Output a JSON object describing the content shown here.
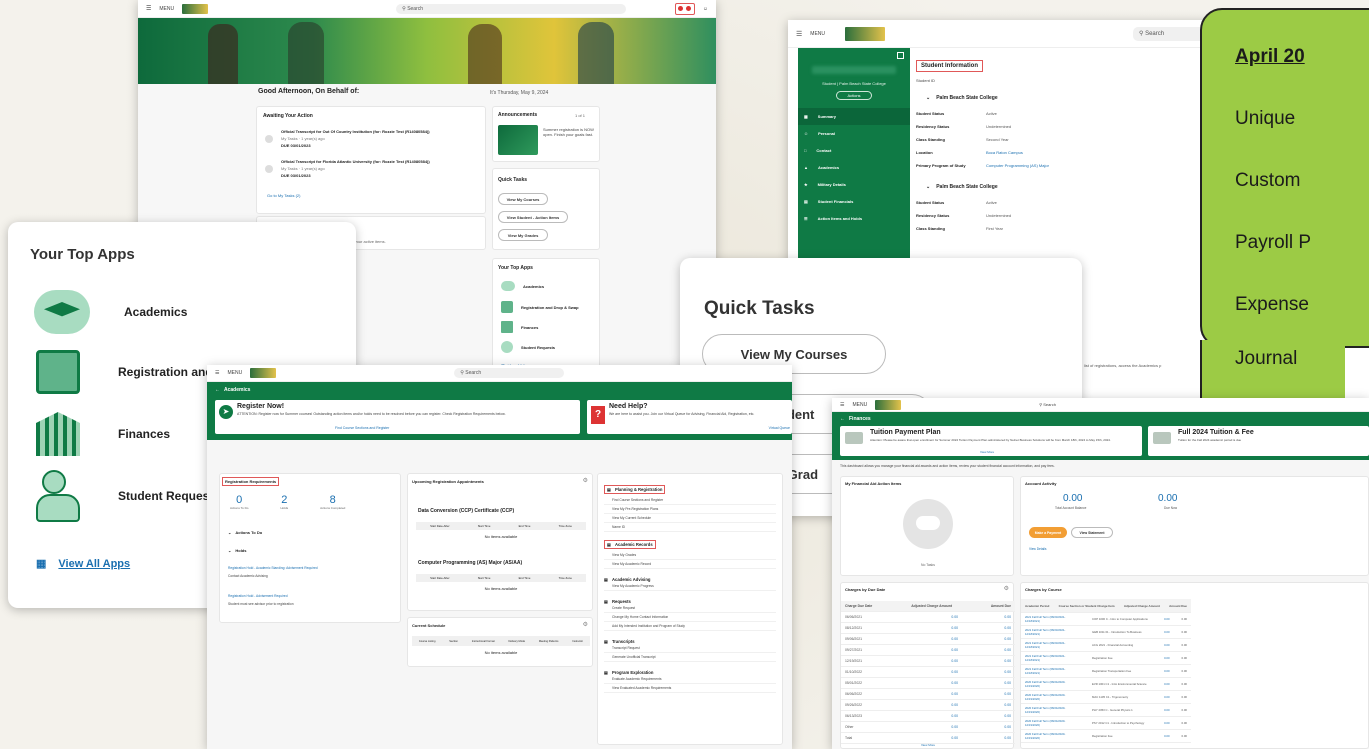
{
  "dashboard": {
    "menu": "MENU",
    "search_placeholder": "Search",
    "greeting": "Good Afternoon, On Behalf of:",
    "date_text": "It's Thursday, May 9, 2024",
    "awaiting_title": "Awaiting Your Action",
    "task1_title": "Official Transcript for Out Of Country Institution (for: Rozzie Test (R14080584))",
    "task1_meta": "My Tasks · 1 year(s) ago",
    "task1_date": "DUE 03/01/2023",
    "task2_title": "Official Transcript for Florida Atlantic University (for: Rozzie Test (R14080584))",
    "task2_meta": "My Tasks · 1 year(s) ago",
    "task2_date": "DUE 03/01/2023",
    "go_to_tasks": "Go to My Tasks (2)",
    "updates_text": "get updates on your active items.",
    "announcements_title": "Announcements",
    "announcements_count": "1 of 1",
    "announcement_text": "Summer registration is NOW open. Finish your goals fast.",
    "quick_tasks_title": "Quick Tasks",
    "qt_courses": "View My Courses",
    "qt_student": "View Student - Action Items",
    "qt_grades": "View My Grades",
    "top_apps_title": "Your Top Apps",
    "app_academics": "Academics",
    "app_registration": "Registration and Drop & Swap",
    "app_finances": "Finances",
    "app_requests": "Student Requests",
    "view_all": "View All Apps"
  },
  "top_apps_zoom": {
    "title": "Your Top Apps",
    "apps": [
      "Academics",
      "Registration and Drop & Swap",
      "Finances",
      "Student Requests"
    ],
    "view_all": "View All Apps"
  },
  "student_info": {
    "menu": "MENU",
    "search_placeholder": "Search",
    "profile_subtitle": "Student | Palm Beach State College",
    "actions": "Actions",
    "nav": [
      "Summary",
      "Personal",
      "Contact",
      "Academics",
      "Military Details",
      "Student Financials",
      "Action Items and Holds"
    ],
    "title": "Student Information",
    "student_id_label": "Student ID",
    "section1": "Palm Beach State College",
    "rows1": [
      {
        "label": "Student Status",
        "value": "Active"
      },
      {
        "label": "Residency Status",
        "value": "Undetermined"
      },
      {
        "label": "Class Standing",
        "value": "Second Year"
      },
      {
        "label": "Location",
        "value": "Boca Raton Campus"
      },
      {
        "label": "Primary Program of Study",
        "value": "Computer Programming (AS) Major"
      }
    ],
    "section2": "Palm Beach State College",
    "rows2": [
      {
        "label": "Student Status",
        "value": "Active"
      },
      {
        "label": "Residency Status",
        "value": "Undetermined"
      },
      {
        "label": "Class Standing",
        "value": "First Year"
      }
    ],
    "bottom_note": "list of registrations, access the Academics p"
  },
  "quick_tasks_zoom": {
    "title": "Quick Tasks",
    "buttons": [
      "View My Courses",
      "View Student",
      "View My Grad"
    ]
  },
  "academics": {
    "menu": "MENU",
    "search_placeholder": "Search",
    "header": "Academics",
    "register_title": "Register Now!",
    "register_text": "ATTENTION: Register now for Summer courses! Outstanding action items and/or holds need to be resolved before you can register. Check Registration Requirements below.",
    "find_link": "Find Course Sections and Register",
    "help_title": "Need Help?",
    "help_text": "We are here to assist you. Join our Virtual Queue for Advising, Financial Aid, Registration, etc.",
    "virtual_link": "Virtual Queue",
    "req_title": "Registration Requirements",
    "stats": [
      {
        "value": "0",
        "label": "Actions To Do"
      },
      {
        "value": "2",
        "label": "Holds"
      },
      {
        "value": "8",
        "label": "Actions Completed"
      }
    ],
    "actions_todo": "Actions To Do",
    "holds": "Holds",
    "hold1": "Registration Hold - Academic Standing: Advisement Required",
    "hold1_action": "Contact Academic Advising",
    "hold2": "Registration Hold - Advisement Required",
    "hold2_action": "Student must see advisor prior to registration",
    "upcoming_title": "Upcoming Registration Appointments",
    "ccp_title": "Data Conversion (CCP) Certificate (CCP)",
    "aa_title": "Computer Programming (AS) Major (AS/AA)",
    "appt_cols": [
      "Start Date-After",
      "Start Time",
      "End Time",
      "Time Zone"
    ],
    "no_items": "No items available",
    "schedule_title": "Current Schedule",
    "schedule_cols": [
      "Course Listing",
      "Section",
      "Instructional Format",
      "Delivery Mode",
      "Meeting Patterns",
      "Instructor"
    ],
    "menu_sections": [
      {
        "title": "Planning & Registration",
        "items": [
          "Find Course Sections and Register",
          "View My Pre-Registration Plans",
          "View My Current Schedule",
          "Name ID"
        ]
      },
      {
        "title": "Academic Records",
        "items": [
          "View My Grades",
          "View My Academic Record"
        ]
      },
      {
        "title": "Academic Advising",
        "items": [
          "View My Academic Progress"
        ]
      },
      {
        "title": "Requests",
        "items": [
          "Create Request",
          "Change My Home Contact Information",
          "Add My Intended Institution and Program of Study"
        ]
      },
      {
        "title": "Transcripts",
        "items": [
          "Transcript Request",
          "Generate Unofficial Transcript"
        ]
      },
      {
        "title": "Program Exploration",
        "items": [
          "Evaluate Academic Requirements",
          "View Evaluated Academic Requirements"
        ]
      }
    ]
  },
  "finances": {
    "menu": "MENU",
    "search_placeholder": "Search",
    "header": "Finances",
    "plan_title": "Tuition Payment Plan",
    "plan_text": "Attention: Please be aware that open enrollment for Summer 2024 Tuition Payment Plan administered by Nelnet Business Solutions will be from March 18th, 2024 to May 15th, 2024.",
    "view_more": "View More",
    "fall_title": "Full 2024 Tuition & Fee",
    "fall_text": "Tuition for the Fall 2024 academic period is due",
    "intro": "This dashboard allows you manage your financial aid awards and action items, review your student financial account information, and pay fees.",
    "aid_title": "My Financial Aid Action Items",
    "no_tasks": "No Tasks",
    "activity_title": "Account Activity",
    "balance1": "0.00",
    "balance1_label": "Total Account Balance",
    "balance2": "0.00",
    "balance2_label": "Due Now",
    "pay_btn": "Make a Payment",
    "statement_btn": "View Statement",
    "view_details": "View Details",
    "due_title": "Charges by Due Date",
    "due_cols": [
      "Charge Due Date",
      "Adjusted Charge Amount",
      "Amount Due"
    ],
    "due_rows": [
      "06/06/2021",
      "08/12/2021",
      "09/06/2021",
      "09/27/2021",
      "12/19/2021",
      "01/10/2022",
      "05/01/2022",
      "06/06/2022",
      "09/26/2022",
      "06/13/2023",
      "Other",
      "Total"
    ],
    "zero": "0.00",
    "course_title": "Charges by Course",
    "course_cols": [
      "Academic Period",
      "Course Section or Student Charge Item",
      "Adjusted Charge Amount",
      "Amount Due"
    ],
    "course_rows": [
      {
        "period": "2021 Fall Full Term (08/23/2021-12/18/2021)",
        "item": "COP 1000 C - Intro to Computer Applications"
      },
      {
        "period": "2021 Fall Full Term (08/23/2021-12/18/2021)",
        "item": "GEB 1011 01 - Introduction To Business"
      },
      {
        "period": "2021 Fall Full Term (08/23/2021-12/18/2021)",
        "item": "ACG 2021 - Financial Accounting"
      },
      {
        "period": "2021 Fall Full Term (08/23/2021-12/18/2021)",
        "item": "Registration Fee"
      },
      {
        "period": "2021 Fall Full Term (08/23/2021-12/18/2021)",
        "item": "Registration Transportation Fee"
      },
      {
        "period": "2020 Fall Full Term (08/24/2020-12/19/2020)",
        "item": "EVR 1001 C1 - Intro Environmental Science"
      },
      {
        "period": "2020 Fall Full Term (08/24/2020-12/19/2020)",
        "item": "MAC 1105 C1 - Trigonometry"
      },
      {
        "period": "2020 Fall Full Term (08/24/2020-12/19/2020)",
        "item": "PHY 2053 C - General Physics 1"
      },
      {
        "period": "2020 Fall Full Term (08/24/2020-12/19/2020)",
        "item": "PSY 2012 C1 - Introduction to Psychology"
      },
      {
        "period": "2020 Fall Full Term (08/24/2020-12/19/2020)",
        "item": "Registration Fee"
      }
    ]
  },
  "callout": {
    "title": "April 20",
    "items": [
      "Unique",
      "Custom",
      "Payroll P",
      "Expense",
      "Journal"
    ]
  }
}
